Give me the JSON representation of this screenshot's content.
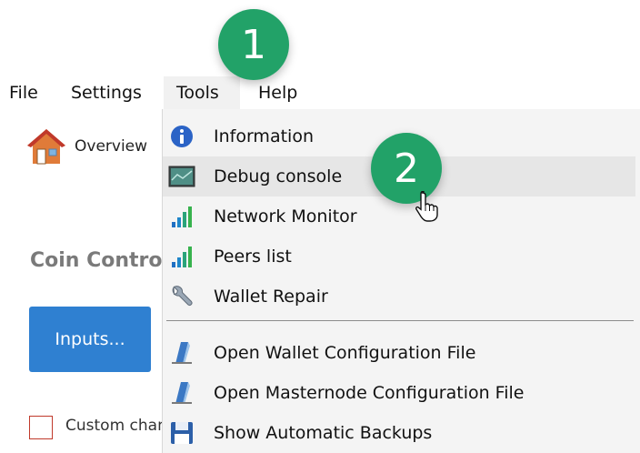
{
  "menubar": {
    "items": [
      {
        "label": "File"
      },
      {
        "label": "Settings"
      },
      {
        "label": "Tools"
      },
      {
        "label": "Help"
      }
    ]
  },
  "toolbar": {
    "overview_label": "Overview"
  },
  "main": {
    "section_title": "Coin Control Features",
    "inputs_button": "Inputs...",
    "custom_change_label": "Custom change address"
  },
  "tools_menu": {
    "items": [
      {
        "label": "Information",
        "icon": "info-icon"
      },
      {
        "label": "Debug console",
        "icon": "console-icon"
      },
      {
        "label": "Network Monitor",
        "icon": "signal-bars-icon"
      },
      {
        "label": "Peers list",
        "icon": "signal-bars-icon"
      },
      {
        "label": "Wallet Repair",
        "icon": "wrench-icon"
      },
      {
        "label": "Open Wallet Configuration File",
        "icon": "edit-file-icon"
      },
      {
        "label": "Open Masternode Configuration File",
        "icon": "edit-file-icon"
      },
      {
        "label": "Show Automatic Backups",
        "icon": "floppy-disk-icon"
      }
    ]
  },
  "annotations": {
    "badge1": "1",
    "badge2": "2"
  },
  "colors": {
    "accent": "#2f80d1",
    "badge": "#22a268",
    "checkbox_border": "#c0392b"
  }
}
